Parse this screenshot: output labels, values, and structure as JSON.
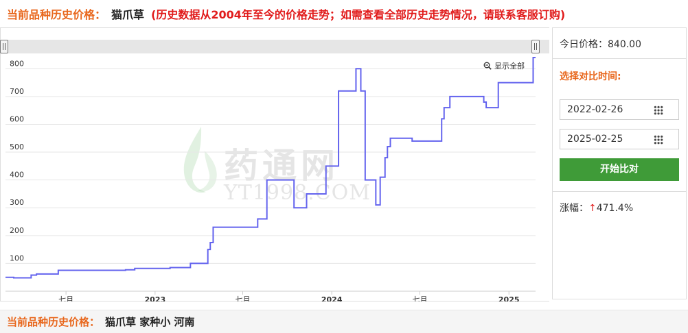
{
  "header": {
    "label": "当前品种历史价格：",
    "name": "猫爪草",
    "note": "(历史数据从2004年至今的价格走势；如需查看全部历史走势情况，请联系客服订购)"
  },
  "zoom_all_label": "显示全部",
  "watermark": {
    "text": "药通网",
    "sub": "YT1998.COM"
  },
  "sidebar": {
    "today_label": "今日价格：",
    "today_value": "840.00",
    "compare_label": "选择对比时间:",
    "start_date": "2022-02-26",
    "end_date": "2025-02-25",
    "start_button": "开始比对",
    "change_label": "涨幅：",
    "change_arrow": "↑",
    "change_value": "471.4%"
  },
  "footer": {
    "label": "当前品种历史价格：",
    "name": "猫爪草 家种小 河南"
  },
  "chart_data": {
    "type": "line",
    "title": "",
    "xlabel": "",
    "ylabel": "",
    "ylim": [
      0,
      850
    ],
    "yticks": [
      100,
      200,
      300,
      400,
      500,
      600,
      700,
      800
    ],
    "xlim": [
      "2022-02-26",
      "2025-02-25"
    ],
    "xticks": [
      {
        "date": "2022-07-01",
        "label": "七月",
        "bold": false
      },
      {
        "date": "2023-01-01",
        "label": "2023",
        "bold": true
      },
      {
        "date": "2023-07-01",
        "label": "七月",
        "bold": false
      },
      {
        "date": "2024-01-01",
        "label": "2024",
        "bold": true
      },
      {
        "date": "2024-07-01",
        "label": "七月",
        "bold": false
      },
      {
        "date": "2025-01-01",
        "label": "2025",
        "bold": true
      }
    ],
    "grid": true,
    "step": true,
    "color": "#6363ee",
    "series": [
      {
        "name": "",
        "points": [
          [
            "2022-02-26",
            50
          ],
          [
            "2022-03-15",
            48
          ],
          [
            "2022-04-20",
            58
          ],
          [
            "2022-05-01",
            62
          ],
          [
            "2022-06-01",
            62
          ],
          [
            "2022-06-15",
            75
          ],
          [
            "2022-11-01",
            77
          ],
          [
            "2022-11-20",
            82
          ],
          [
            "2023-02-01",
            85
          ],
          [
            "2023-03-15",
            100
          ],
          [
            "2023-04-20",
            150
          ],
          [
            "2023-04-25",
            175
          ],
          [
            "2023-05-01",
            230
          ],
          [
            "2023-08-01",
            260
          ],
          [
            "2023-08-20",
            400
          ],
          [
            "2023-10-15",
            300
          ],
          [
            "2023-11-10",
            350
          ],
          [
            "2023-12-20",
            450
          ],
          [
            "2024-01-15",
            720
          ],
          [
            "2024-02-20",
            800
          ],
          [
            "2024-03-01",
            720
          ],
          [
            "2024-03-10",
            400
          ],
          [
            "2024-04-01",
            310
          ],
          [
            "2024-04-10",
            410
          ],
          [
            "2024-04-20",
            480
          ],
          [
            "2024-04-25",
            520
          ],
          [
            "2024-05-01",
            550
          ],
          [
            "2024-06-15",
            540
          ],
          [
            "2024-08-15",
            620
          ],
          [
            "2024-08-20",
            660
          ],
          [
            "2024-09-01",
            700
          ],
          [
            "2024-11-10",
            680
          ],
          [
            "2024-11-15",
            660
          ],
          [
            "2024-12-10",
            750
          ],
          [
            "2025-02-20",
            840
          ],
          [
            "2025-02-25",
            840
          ]
        ]
      }
    ]
  }
}
